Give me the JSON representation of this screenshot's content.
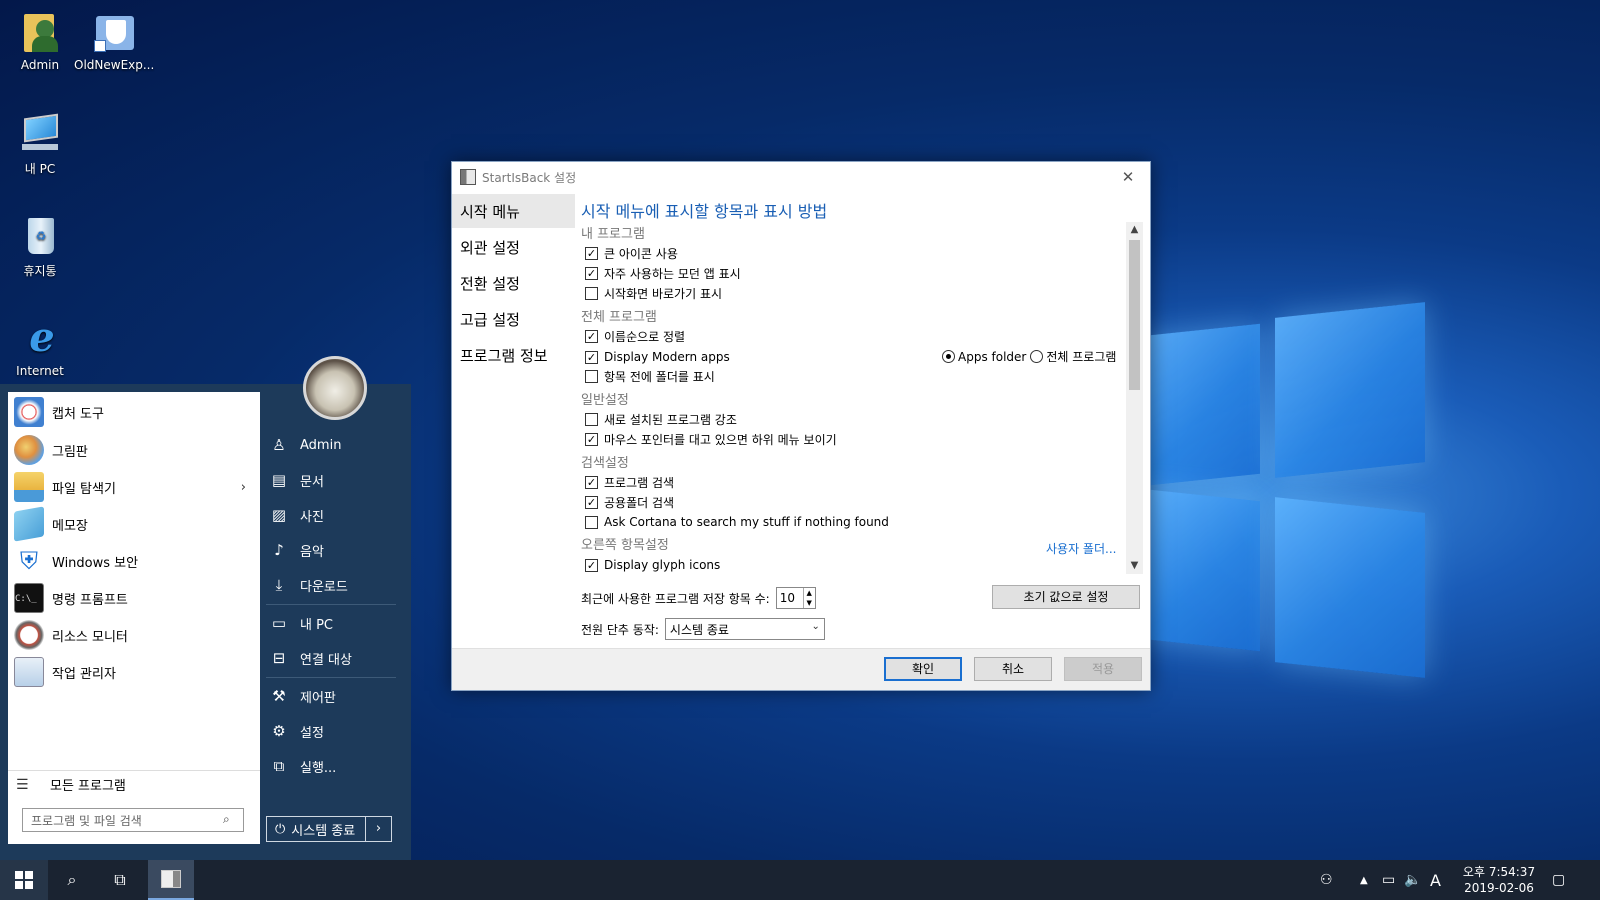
{
  "desktop": {
    "icons": [
      {
        "label": "Admin"
      },
      {
        "label": "OldNewExp..."
      },
      {
        "label": "내 PC"
      },
      {
        "label": "휴지통"
      },
      {
        "label": "Internet"
      }
    ]
  },
  "start_menu": {
    "programs": [
      {
        "label": "캡처 도구"
      },
      {
        "label": "그림판"
      },
      {
        "label": "파일 탐색기"
      },
      {
        "label": "메모장"
      },
      {
        "label": "Windows 보안"
      },
      {
        "label": "명령 프롬프트"
      },
      {
        "label": "리소스 모니터"
      },
      {
        "label": "작업 관리자"
      }
    ],
    "all_programs": "모든 프로그램",
    "search_placeholder": "프로그램 및 파일 검색",
    "right_items": [
      {
        "label": "Admin"
      },
      {
        "label": "문서"
      },
      {
        "label": "사진"
      },
      {
        "label": "음악"
      },
      {
        "label": "다운로드"
      },
      {
        "label": "내 PC"
      },
      {
        "label": "연결 대상"
      },
      {
        "label": "제어판"
      },
      {
        "label": "설정"
      },
      {
        "label": "실행..."
      }
    ],
    "shutdown_label": "시스템 종료"
  },
  "dialog": {
    "title": "StartIsBack 설정",
    "nav": [
      {
        "label": "시작 메뉴"
      },
      {
        "label": "외관 설정"
      },
      {
        "label": "전환 설정"
      },
      {
        "label": "고급 설정"
      },
      {
        "label": "프로그램 정보"
      }
    ],
    "heading": "시작 메뉴에 표시할 항목과 표시 방법",
    "groups": {
      "my_programs": "내 프로그램",
      "all_programs": "전체 프로그램",
      "general": "일반설정",
      "search": "검색설정",
      "right": "오른쪽 항목설정"
    },
    "options": {
      "large_icons": {
        "label": "큰 아이콘 사용",
        "checked": true
      },
      "frequent_modern": {
        "label": "자주 사용하는 모던 앱 표시",
        "checked": true
      },
      "start_shortcut": {
        "label": "시작화면 바로가기 표시",
        "checked": false
      },
      "sort_by_name": {
        "label": "이름순으로 정렬",
        "checked": true
      },
      "display_modern": {
        "label": "Display Modern apps",
        "checked": true
      },
      "folders_first": {
        "label": "항목 전에 폴더를 표시",
        "checked": false
      },
      "highlight_new": {
        "label": "새로 설치된 프로그램 강조",
        "checked": false
      },
      "hover_submenu": {
        "label": "마우스 포인터를 대고 있으면 하위 메뉴 보이기",
        "checked": true
      },
      "search_programs": {
        "label": "프로그램 검색",
        "checked": true
      },
      "search_public": {
        "label": "공용폴더 검색",
        "checked": true
      },
      "ask_cortana": {
        "label": "Ask Cortana to search my stuff if nothing found",
        "checked": false
      },
      "glyph_icons": {
        "label": "Display glyph icons",
        "checked": true
      }
    },
    "radio": {
      "apps_folder": "Apps folder",
      "all_programs": "전체 프로그램"
    },
    "user_folder_link": "사용자 폴더...",
    "recent_label": "최근에 사용한 프로그램 저장 항목 수:",
    "recent_value": "10",
    "reset_label": "초기 값으로 설정",
    "power_label": "전원 단추 동작:",
    "power_value": "시스템 종료",
    "ok_label": "확인",
    "cancel_label": "취소",
    "apply_label": "적용"
  },
  "taskbar": {
    "ime": "A",
    "time": "오후 7:54:37",
    "date": "2019-02-06"
  }
}
